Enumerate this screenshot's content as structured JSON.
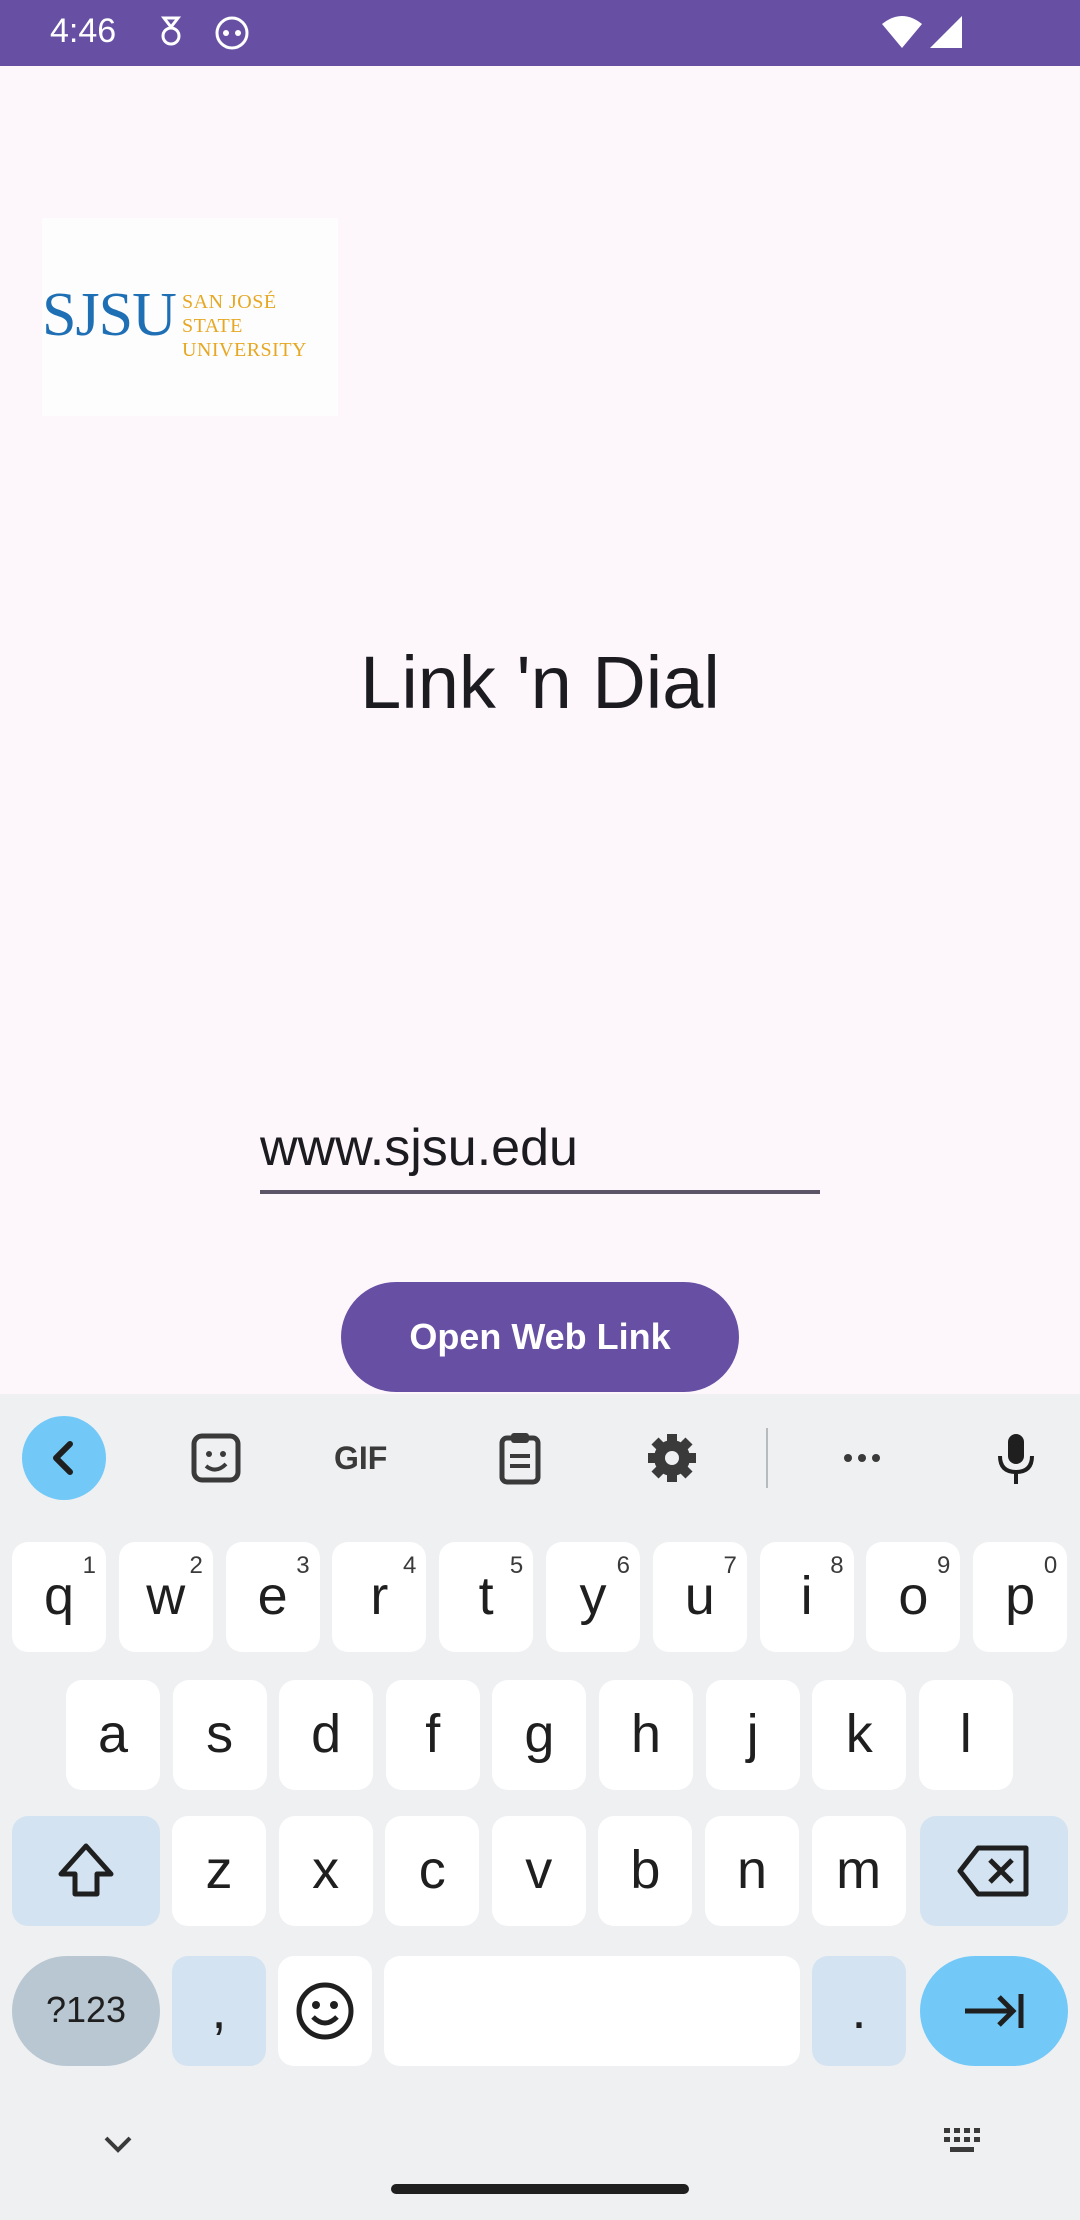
{
  "status_bar": {
    "time": "4:46",
    "icons": [
      "assistant-status-icon",
      "cat-face-icon",
      "wifi-icon",
      "cell-signal-icon"
    ],
    "color": "#6750a4"
  },
  "logo": {
    "main": "SJSU",
    "line1": "SAN JOSÉ STATE",
    "line2": "UNIVERSITY"
  },
  "app": {
    "title": "Link 'n Dial",
    "url_input_value": "www.sjsu.edu",
    "open_button_label": "Open Web Link",
    "accent": "#6750a4"
  },
  "keyboard": {
    "toolbar_icons": [
      "back-icon",
      "sticker-icon",
      "gif-icon",
      "clipboard-icon",
      "settings-icon",
      "more-icon",
      "mic-icon"
    ],
    "gif_label": "GIF",
    "row1": [
      {
        "k": "q",
        "n": "1"
      },
      {
        "k": "w",
        "n": "2"
      },
      {
        "k": "e",
        "n": "3"
      },
      {
        "k": "r",
        "n": "4"
      },
      {
        "k": "t",
        "n": "5"
      },
      {
        "k": "y",
        "n": "6"
      },
      {
        "k": "u",
        "n": "7"
      },
      {
        "k": "i",
        "n": "8"
      },
      {
        "k": "o",
        "n": "9"
      },
      {
        "k": "p",
        "n": "0"
      }
    ],
    "row2": [
      "a",
      "s",
      "d",
      "f",
      "g",
      "h",
      "j",
      "k",
      "l"
    ],
    "row3": [
      "z",
      "x",
      "c",
      "v",
      "b",
      "n",
      "m"
    ],
    "sym_label": "?123",
    "comma": ",",
    "period": "."
  }
}
